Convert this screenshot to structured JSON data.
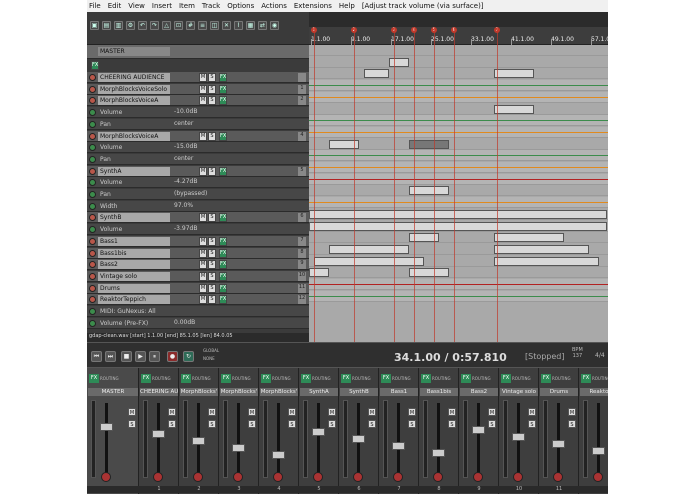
{
  "menu": [
    "File",
    "Edit",
    "View",
    "Insert",
    "Item",
    "Track",
    "Options",
    "Actions",
    "Extensions",
    "Help",
    "[Adjust track volume (via surface)]"
  ],
  "master": {
    "label": "MASTER",
    "fx": "FX"
  },
  "tracks": [
    {
      "name": "CHEERING AUDIENCE",
      "num": "",
      "kind": "track"
    },
    {
      "name": "MorphBlocksVoiceSolo",
      "num": "1",
      "kind": "track"
    },
    {
      "name": "MorphBlocksVoiceA",
      "num": "2",
      "kind": "track"
    },
    {
      "name": "Volume",
      "value": "-10.0dB",
      "kind": "env"
    },
    {
      "name": "Pan",
      "value": "center",
      "kind": "env"
    },
    {
      "name": "MorphBlocksVoiceA",
      "num": "4",
      "kind": "track"
    },
    {
      "name": "Volume",
      "value": "-15.0dB",
      "kind": "env"
    },
    {
      "name": "Pan",
      "value": "center",
      "kind": "env"
    },
    {
      "name": "SynthA",
      "num": "5",
      "kind": "track"
    },
    {
      "name": "Volume",
      "value": "-4.27dB",
      "kind": "env"
    },
    {
      "name": "Pan",
      "value": "(bypassed)",
      "kind": "env"
    },
    {
      "name": "Width",
      "value": "97.0%",
      "kind": "env"
    },
    {
      "name": "SynthB",
      "num": "6",
      "kind": "track"
    },
    {
      "name": "Volume",
      "value": "-3.97dB",
      "kind": "env"
    },
    {
      "name": "Bass1",
      "num": "7",
      "kind": "track"
    },
    {
      "name": "Bass1bis",
      "num": "8",
      "kind": "track"
    },
    {
      "name": "Bass2",
      "num": "9",
      "kind": "track"
    },
    {
      "name": "Vintage solo",
      "num": "10",
      "kind": "track"
    },
    {
      "name": "Drums",
      "num": "11",
      "kind": "track"
    },
    {
      "name": "ReaktorTeppich",
      "num": "12",
      "kind": "track"
    },
    {
      "name": "MIDI: GuNexus: All",
      "value": "",
      "kind": "env"
    },
    {
      "name": "Volume (Pre-FX)",
      "value": "0.00dB",
      "kind": "env"
    }
  ],
  "ruler": {
    "marks": [
      "1.1.00",
      "9.1.00",
      "17.1.00",
      "25.1.00",
      "33.1.00",
      "41.1.00",
      "49.1.00",
      "57.1.0"
    ],
    "markers": [
      "1",
      "2",
      "3",
      "4",
      "5",
      "6",
      "7"
    ]
  },
  "info_line": "gdap-clean.wav [start] 1.1.00 [end] 85.1.05 [len] 84.0.05",
  "transport": {
    "time": "34.1.00 / 0:57.810",
    "status": "[Stopped]",
    "bpm_label": "BPM",
    "bpm": "137",
    "sig": "4/4",
    "global": "GLOBAL",
    "none": "NONE"
  },
  "mixer": {
    "strips": [
      {
        "name": "MASTER",
        "num": ""
      },
      {
        "name": "CHEERING AUI",
        "num": "1"
      },
      {
        "name": "MorphBlocks'",
        "num": "2"
      },
      {
        "name": "MorphBlocks'",
        "num": "3"
      },
      {
        "name": "MorphBlocks'",
        "num": "4"
      },
      {
        "name": "SynthA",
        "num": "5"
      },
      {
        "name": "SynthB",
        "num": "6"
      },
      {
        "name": "Bass1",
        "num": "7"
      },
      {
        "name": "Bass1bis",
        "num": "8"
      },
      {
        "name": "Bass2",
        "num": "9"
      },
      {
        "name": "Vintage solo",
        "num": "10"
      },
      {
        "name": "Drums",
        "num": "11"
      },
      {
        "name": "Reakto",
        "num": ""
      }
    ],
    "fx": "FX",
    "routing": "ROUTING",
    "m": "M",
    "s": "S"
  },
  "colors": {
    "marker": "#c0392b",
    "fx": "#2e8b57",
    "env_green": "#3c8c4c",
    "env_orange": "#e08a1e",
    "env_red": "#b22222"
  }
}
